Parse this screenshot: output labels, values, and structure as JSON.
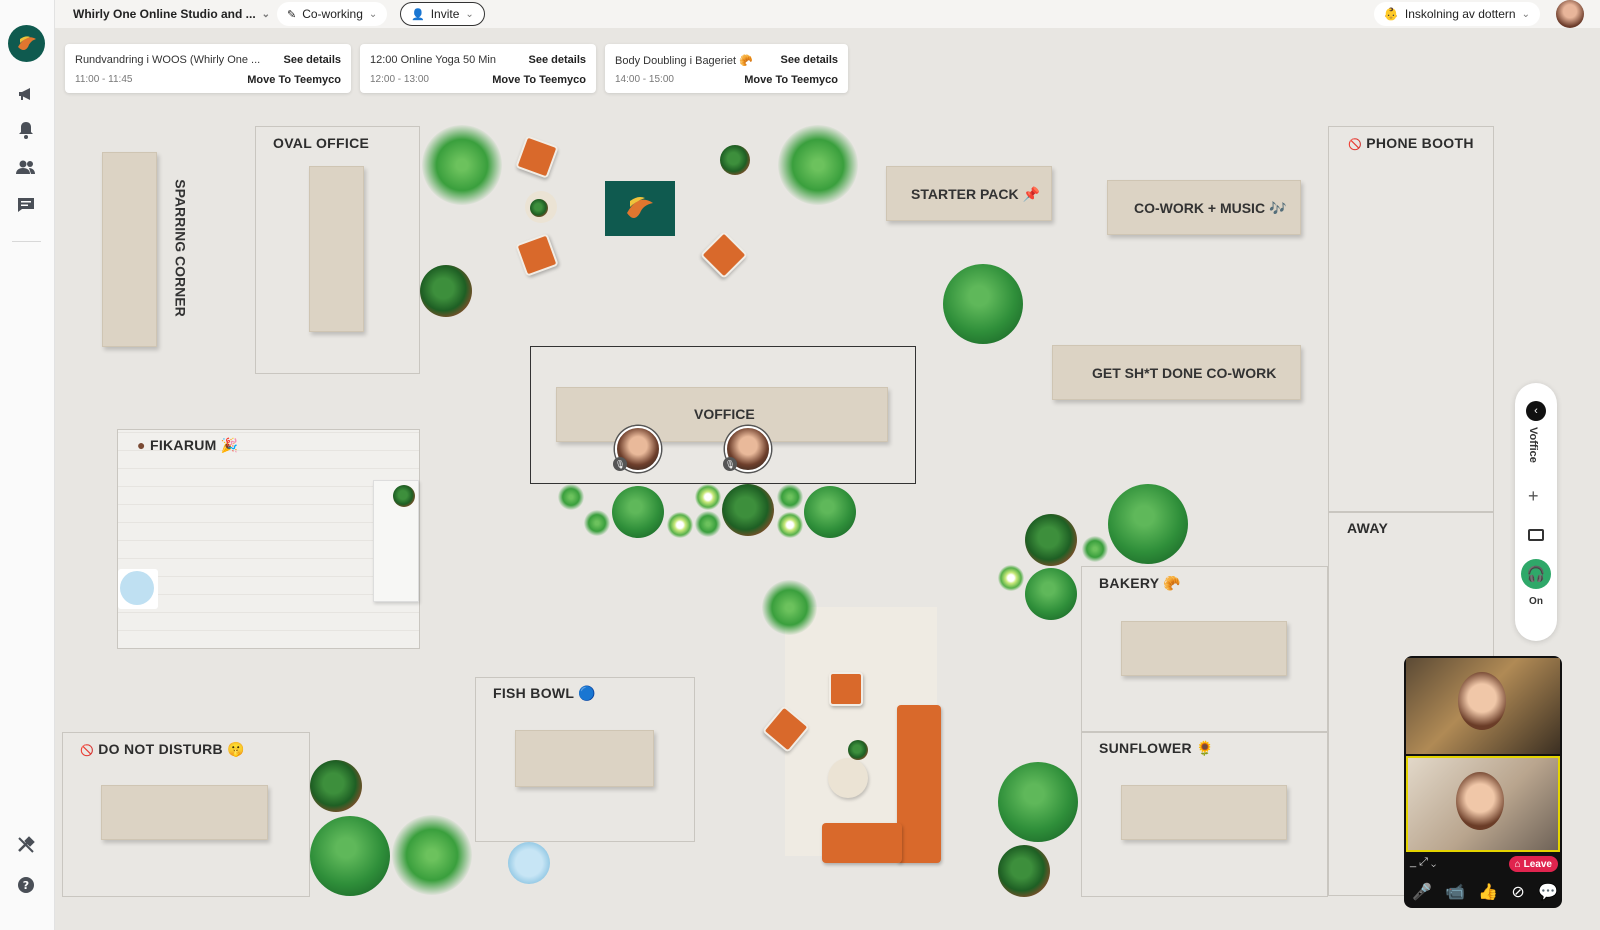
{
  "topbar": {
    "org_name": "Whirly One Online Studio and ...",
    "mode_label": "Co-working",
    "invite_label": "Invite",
    "status_label": "Inskolning av dottern"
  },
  "events": [
    {
      "title": "Rundvandring i WOOS (Whirly One ...",
      "time": "11:00 - 11:45",
      "details": "See details",
      "move": "Move To Teemyco"
    },
    {
      "title": "12:00 Online Yoga 50 Min",
      "time": "12:00 - 13:00",
      "details": "See details",
      "move": "Move To Teemyco"
    },
    {
      "title": "Body Doubling i Bageriet 🥐",
      "time": "14:00 - 15:00",
      "details": "See details",
      "move": "Move To Teemyco"
    }
  ],
  "rooms": {
    "sparring": "SPARRING CORNER",
    "oval": "OVAL OFFICE",
    "phone": "PHONE BOOTH",
    "fikarum": "FIKARUM 🎉",
    "voffice": "VOFFICE",
    "starter": "STARTER PACK 📌",
    "cowork": "CO-WORK + MUSIC 🎶",
    "gsd": "GET SH*T DONE CO-WORK",
    "away": "AWAY",
    "bakery": "BAKERY 🥐",
    "fishbowl": "FISH BOWL 🔵",
    "dnd": "DO NOT DISTURB 🤫",
    "sunflower": "SUNFLOWER 🌻"
  },
  "dock": {
    "room_name": "Voffice",
    "audio_state": "On"
  },
  "video": {
    "leave_label": "Leave"
  },
  "colors": {
    "chair": "#d9692b",
    "floor": "#e8e6e2",
    "leave": "#e0244e",
    "audio_on": "#2fa869",
    "brand": "#0f5a4f"
  }
}
